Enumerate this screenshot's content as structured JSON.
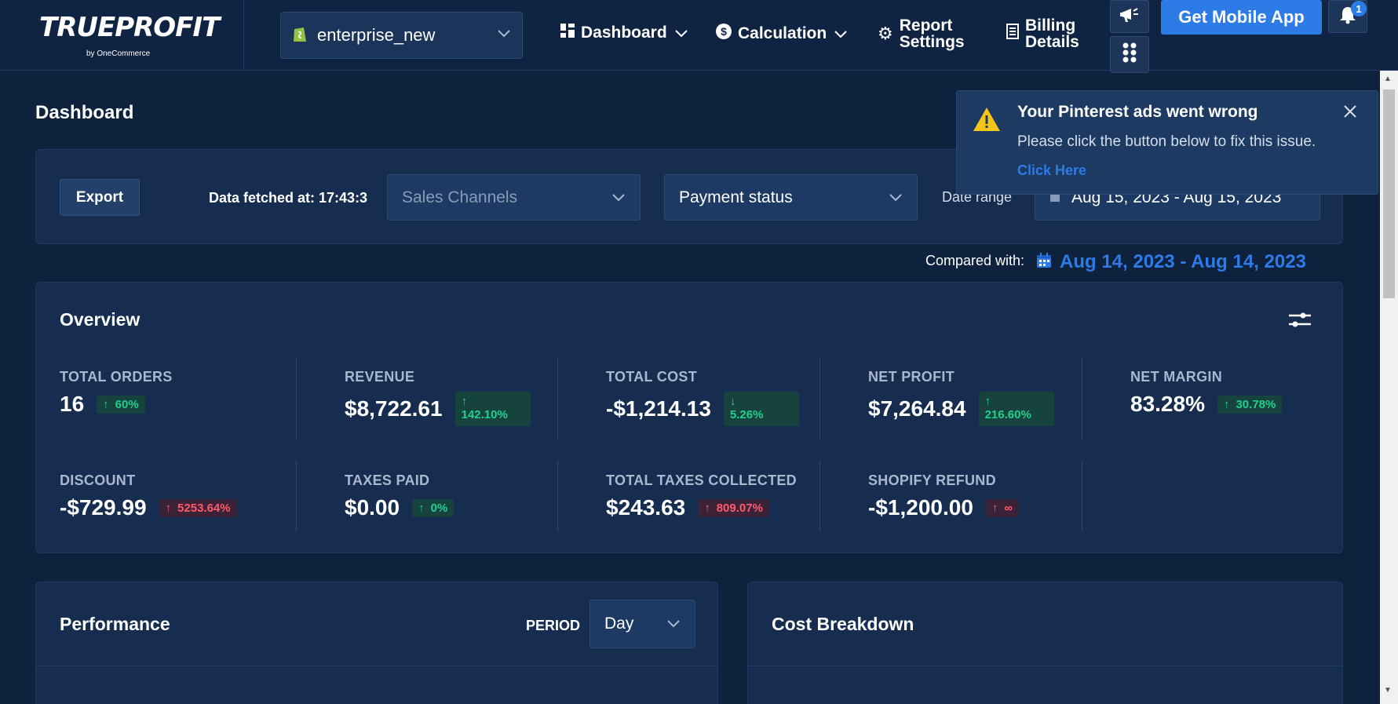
{
  "nav": {
    "logo_text": "TRUEPROFIT",
    "logo_sub": "by OneCommerce",
    "store": "enterprise_new",
    "items": [
      {
        "label": "Dashboard"
      },
      {
        "label": "Calculation"
      },
      {
        "label_1": "Report",
        "label_2": "Settings"
      },
      {
        "label_1": "Billing",
        "label_2": "Details"
      }
    ],
    "mobile_btn": "Get Mobile App",
    "notif_count": "1"
  },
  "page": {
    "title": "Dashboard"
  },
  "filters": {
    "export_label": "Export",
    "fetched": "Data fetched at: 17:43:3",
    "sales_channels_placeholder": "Sales Channels",
    "payment_status": "Payment status",
    "date_range_label": "Date range",
    "date_range_value": "Aug 15, 2023 - Aug 15, 2023",
    "compared_label": "Compared with:",
    "compared_value": "Aug 14, 2023 - Aug 14, 2023"
  },
  "toast": {
    "title": "Your Pinterest ads went wrong",
    "message": "Please click the button below to fix this issue.",
    "link": "Click Here"
  },
  "overview": {
    "title": "Overview",
    "metrics": [
      {
        "label": "TOTAL ORDERS",
        "value": "16",
        "change": "60%",
        "dir": "up",
        "tone": "good"
      },
      {
        "label": "REVENUE",
        "value": "$8,722.61",
        "change": "142.10%",
        "dir": "up",
        "tone": "good"
      },
      {
        "label": "TOTAL COST",
        "value": "-$1,214.13",
        "change": "5.26%",
        "dir": "down",
        "tone": "good"
      },
      {
        "label": "NET PROFIT",
        "value": "$7,264.84",
        "change": "216.60%",
        "dir": "up",
        "tone": "good"
      },
      {
        "label": "NET MARGIN",
        "value": "83.28%",
        "change": "30.78%",
        "dir": "up",
        "tone": "good"
      },
      {
        "label": "DISCOUNT",
        "value": "-$729.99",
        "change": "5253.64%",
        "dir": "up",
        "tone": "bad"
      },
      {
        "label": "TAXES PAID",
        "value": "$0.00",
        "change": "0%",
        "dir": "up",
        "tone": "good"
      },
      {
        "label": "TOTAL TAXES COLLECTED",
        "value": "$243.63",
        "change": "809.07%",
        "dir": "up",
        "tone": "bad"
      },
      {
        "label": "SHOPIFY REFUND",
        "value": "-$1,200.00",
        "change": "∞",
        "dir": "up",
        "tone": "bad"
      }
    ]
  },
  "performance": {
    "title": "Performance",
    "period_label": "PERIOD",
    "period_value": "Day"
  },
  "cost_breakdown": {
    "title": "Cost Breakdown"
  },
  "colors": {
    "accent": "#2d7be6",
    "positive": "#20d08c",
    "negative": "#ff5a6a",
    "warning": "#f5c518"
  }
}
